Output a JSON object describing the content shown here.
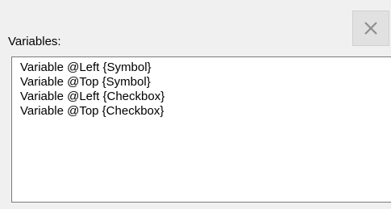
{
  "header": {
    "close_icon": "close-icon"
  },
  "variables": {
    "label": "Variables:",
    "items": [
      {
        "label": "Variable @Left {Symbol}"
      },
      {
        "label": "Variable @Top {Symbol}"
      },
      {
        "label": "Variable @Left {Checkbox}"
      },
      {
        "label": "Variable @Top {Checkbox}"
      }
    ]
  }
}
